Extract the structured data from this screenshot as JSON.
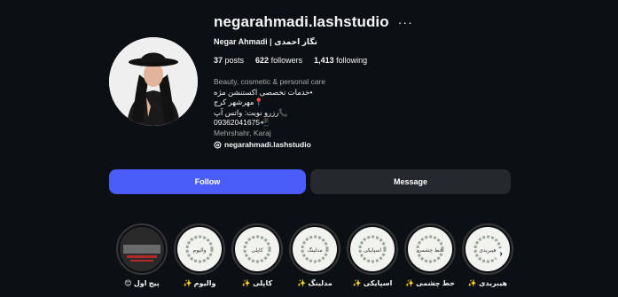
{
  "profile": {
    "username": "negarahmadi.lashstudio",
    "full_name": "Negar Ahmadi | نگار احمدی",
    "stats": {
      "posts_count": "37",
      "posts_label": "posts",
      "followers_count": "622",
      "followers_label": "followers",
      "following_count": "1,413",
      "following_label": "following"
    },
    "category": "Beauty, cosmetic & personal care",
    "bio_lines": [
      "•خدمات تخصصی اکستنشن مژه",
      "📍مهرشهر کرج",
      "📞رزرو نوبت: واتس آپ",
      "09362041675📲"
    ],
    "location": "Mehrshahr, Karaj",
    "threads_handle": "negarahmadi.lashstudio"
  },
  "buttons": {
    "follow_label": "Follow",
    "message_label": "Message"
  },
  "highlights": [
    {
      "label": "پیج اول 😊",
      "thumb_text": ""
    },
    {
      "label": "والیوم ✨",
      "thumb_text": "والیوم"
    },
    {
      "label": "کاپلی ✨",
      "thumb_text": "کاپلی"
    },
    {
      "label": "مدلینگ ✨",
      "thumb_text": "مدلینگ"
    },
    {
      "label": "اسپایکی ✨",
      "thumb_text": "اسپایکی"
    },
    {
      "label": "خط چشمی ✨",
      "thumb_text": "خط چشمی"
    },
    {
      "label": "هیبریدی ✨",
      "thumb_text": "هیبریدی"
    }
  ],
  "colors": {
    "background": "#0c1014",
    "follow_button": "#4a5df9",
    "message_button": "#25292e",
    "secondary_text": "#a8a8a8"
  },
  "icons": {
    "more": "more-horizontal-icon",
    "threads": "threads-icon",
    "next": "chevron-right-icon"
  }
}
